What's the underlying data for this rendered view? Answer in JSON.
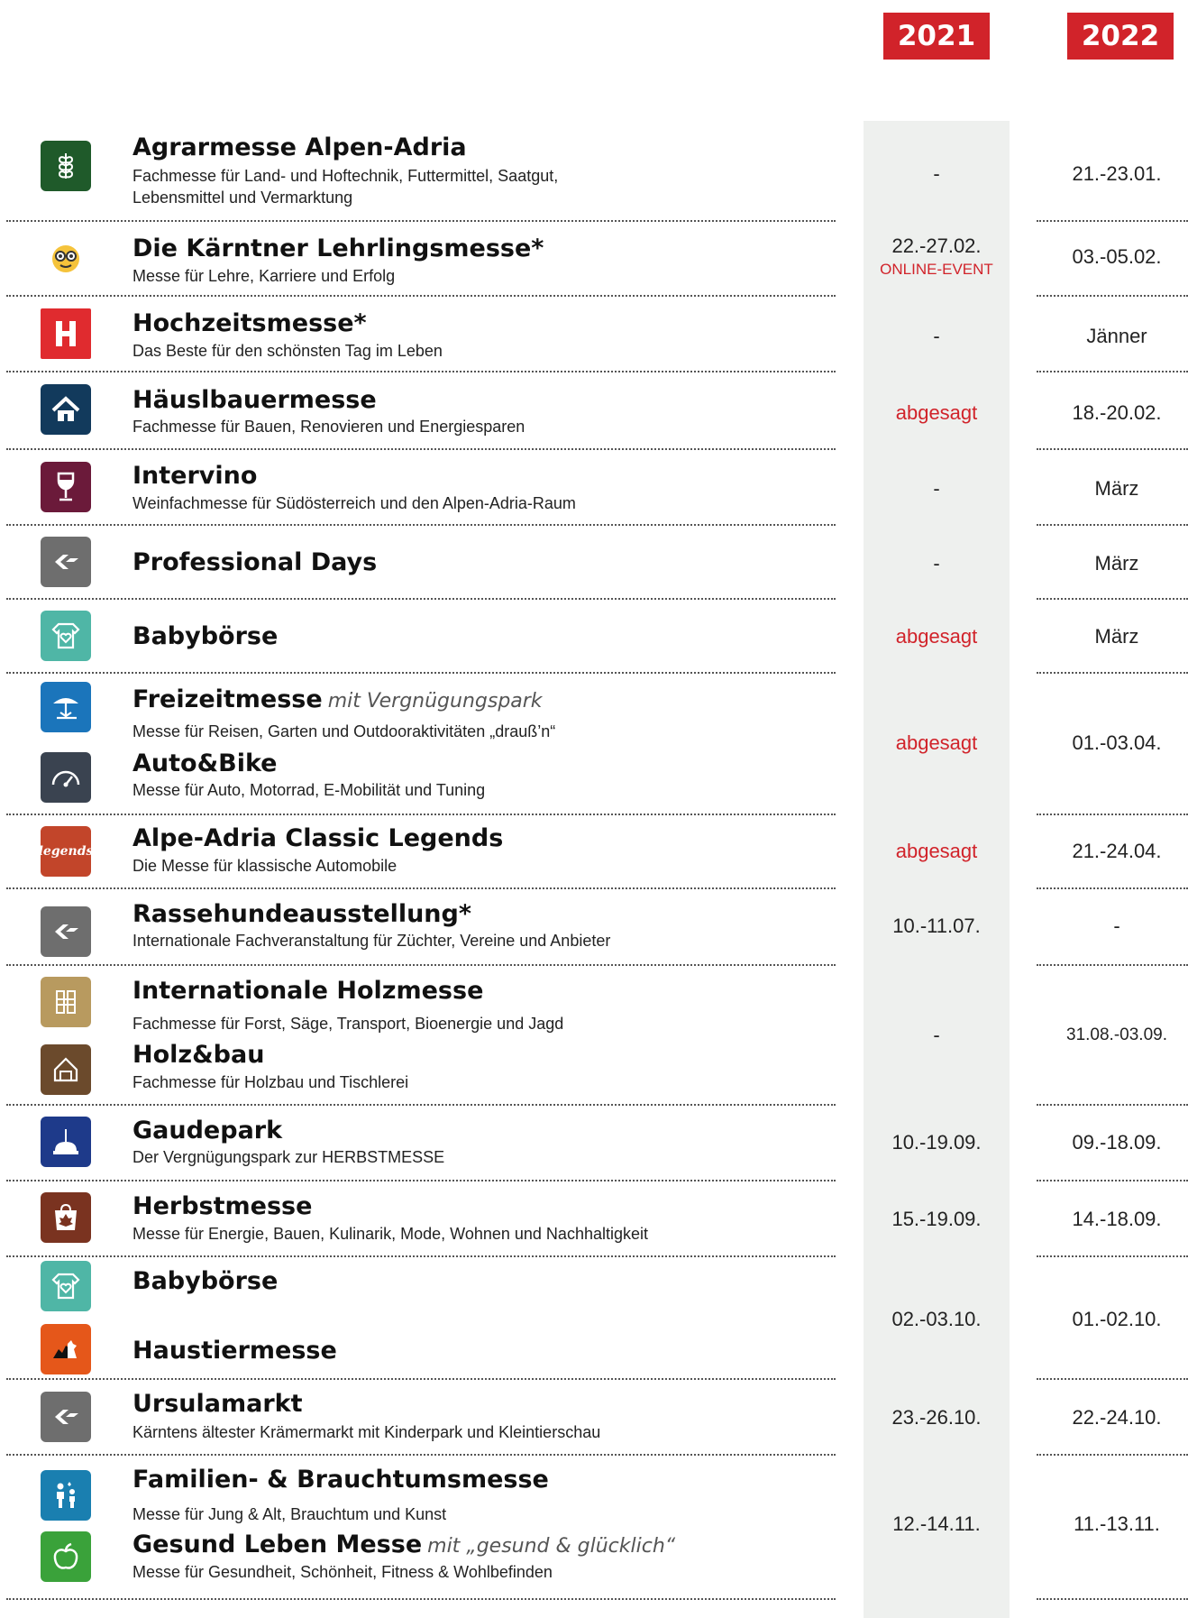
{
  "years": {
    "y2021": "2021",
    "y2022": "2022"
  },
  "events": [
    {
      "title": "Agrarmesse Alpen-Adria",
      "sub": "Fachmesse für Land- und Hoftechnik, Futtermittel, Saatgut,",
      "sub2": "Lebensmittel und Vermarktung",
      "v2021": "-",
      "v2022": "21.-23.01."
    },
    {
      "title": "Die Kärntner Lehrlingsmesse*",
      "sub": "Messe für Lehre, Karriere und Erfolg",
      "v2021": "22.-27.02.",
      "v2021_note": "ONLINE-EVENT",
      "v2022": "03.-05.02."
    },
    {
      "title": "Hochzeitsmesse*",
      "sub": "Das Beste für den schönsten Tag im Leben",
      "v2021": "-",
      "v2022": "Jänner"
    },
    {
      "title": "Häuslbauermesse",
      "sub": "Fachmesse für Bauen, Renovieren und Energiesparen",
      "v2021": "abgesagt",
      "v2022": "18.-20.02."
    },
    {
      "title": "Intervino",
      "sub": "Weinfachmesse für Südösterreich und den Alpen-Adria-Raum",
      "v2021": "-",
      "v2022": "März"
    },
    {
      "title": "Professional Days",
      "v2021": "-",
      "v2022": "März"
    },
    {
      "title": "Babybörse",
      "v2021": "abgesagt",
      "v2022": "März"
    },
    {
      "title": "Freizeitmesse",
      "extra": "mit Vergnügungspark",
      "sub": "Messe für Reisen, Garten und Outdooraktivitäten „drauß’n“",
      "title2": "Auto&Bike",
      "sub2": "Messe für Auto, Motorrad, E-Mobilität und Tuning",
      "v2021": "abgesagt",
      "v2022": "01.-03.04."
    },
    {
      "title": "Alpe-Adria Classic Legends",
      "sub": "Die Messe für klassische Automobile",
      "logo_text": "legends",
      "v2021": "abgesagt",
      "v2022": "21.-24.04."
    },
    {
      "title": "Rassehundeausstellung*",
      "sub": "Internationale Fachveranstaltung für Züchter, Vereine und Anbieter",
      "v2021": "10.-11.07.",
      "v2022": "-"
    },
    {
      "title": "Internationale Holzmesse",
      "sub": "Fachmesse für Forst, Säge, Transport, Bioenergie und Jagd",
      "title2": "Holz&bau",
      "sub2": "Fachmesse für Holzbau und Tischlerei",
      "v2021": "-",
      "v2022": "31.08.-03.09."
    },
    {
      "title": "Gaudepark",
      "sub": "Der Vergnügungspark zur HERBSTMESSE",
      "v2021": "10.-19.09.",
      "v2022": "09.-18.09."
    },
    {
      "title": "Herbstmesse",
      "sub": "Messe für Energie, Bauen, Kulinarik, Mode, Wohnen und Nachhaltigkeit",
      "v2021": "15.-19.09.",
      "v2022": "14.-18.09."
    },
    {
      "title": "Babybörse",
      "title2": "Haustiermesse",
      "v2021": "02.-03.10.",
      "v2022": "01.-02.10."
    },
    {
      "title": "Ursulamarkt",
      "sub": "Kärntens ältester Krämermarkt mit Kinderpark und Kleintierschau",
      "v2021": "23.-26.10.",
      "v2022": "22.-24.10."
    },
    {
      "title": "Familien- & Brauchtumsmesse",
      "sub": "Messe für Jung & Alt, Brauchtum und Kunst",
      "title2": "Gesund Leben Messe",
      "extra2": "mit „gesund & glücklich“",
      "sub2": "Messe für Gesundheit, Schönheit, Fitness & Wohlbefinden",
      "v2021": "12.-14.11.",
      "v2022": "11.-13.11."
    }
  ],
  "colors": {
    "accent": "#d1232a",
    "column_bg": "#eef0ee"
  }
}
